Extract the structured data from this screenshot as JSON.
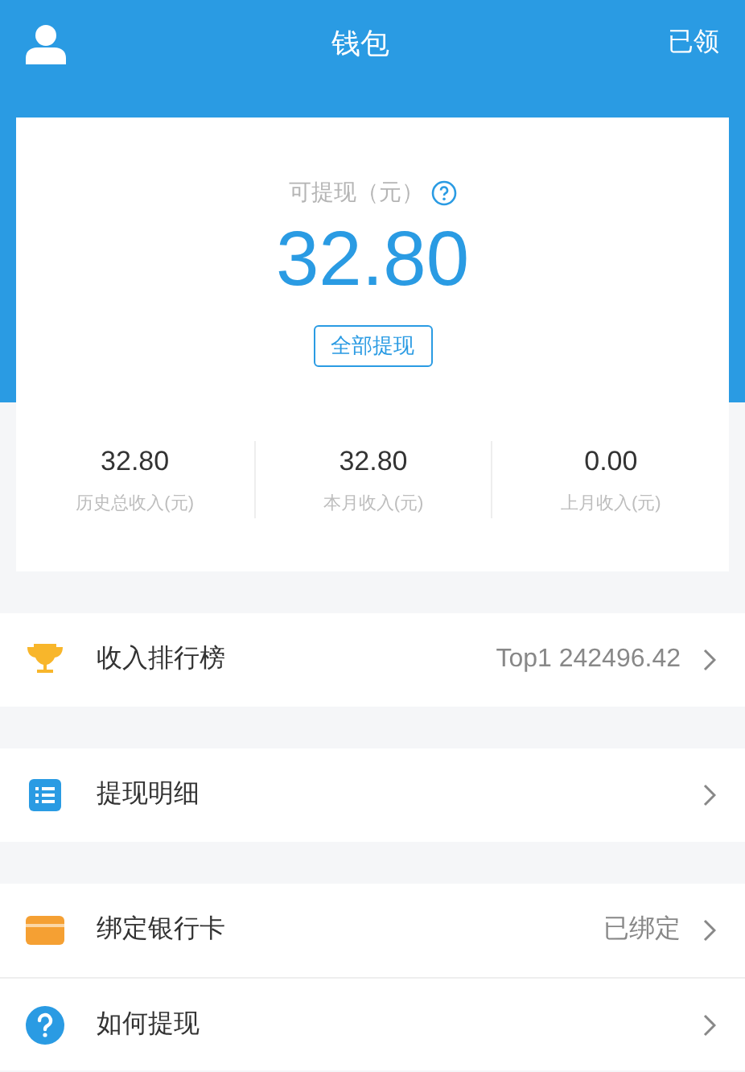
{
  "header": {
    "title": "钱包",
    "action": "已领"
  },
  "balance": {
    "label": "可提现（元）",
    "amount": "32.80",
    "button": "全部提现"
  },
  "stats": [
    {
      "value": "32.80",
      "label": "历史总收入(元)"
    },
    {
      "value": "32.80",
      "label": "本月收入(元)"
    },
    {
      "value": "0.00",
      "label": "上月收入(元)"
    }
  ],
  "menu_groups": [
    [
      {
        "kind": "trophy",
        "label": "收入排行榜",
        "value": "Top1 242496.42"
      }
    ],
    [
      {
        "kind": "list",
        "label": "提现明细"
      }
    ],
    [
      {
        "kind": "card",
        "label": "绑定银行卡",
        "value": "已绑定"
      },
      {
        "kind": "help",
        "label": "如何提现"
      }
    ]
  ]
}
